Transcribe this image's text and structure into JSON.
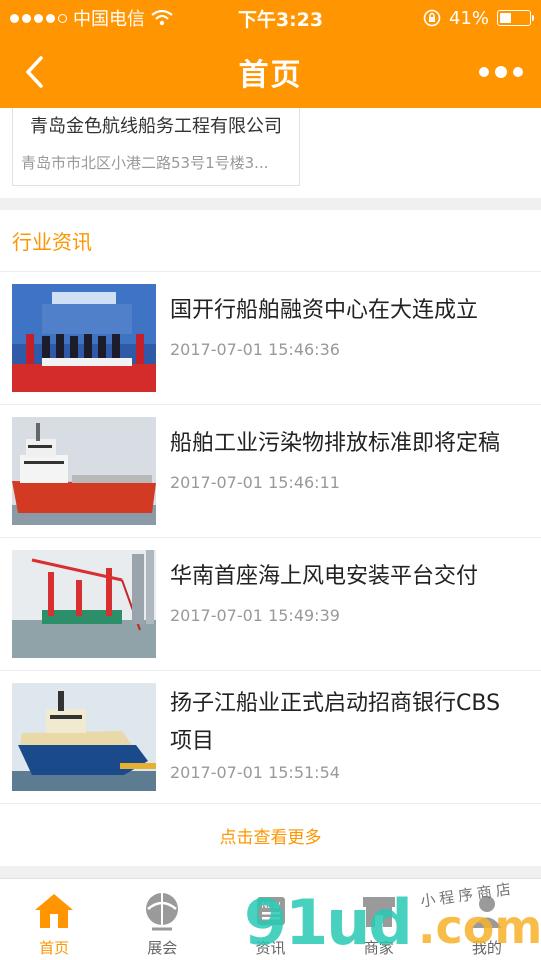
{
  "status_bar": {
    "carrier": "中国电信",
    "time": "下午3:23",
    "battery": "41%",
    "battery_level": 0.41
  },
  "nav": {
    "title": "首页"
  },
  "company": {
    "name": "青岛金色航线船务工程有限公司",
    "address": "青岛市市北区小港二路53号1号楼3..."
  },
  "news": {
    "section_title": "行业资讯",
    "items": [
      {
        "title": "国开行船舶融资中心在大连成立",
        "time": "2017-07-01 15:46:36",
        "thumb": "signing-ceremony-photo"
      },
      {
        "title": "船舶工业污染物排放标准即将定稿",
        "time": "2017-07-01 15:46:11",
        "thumb": "red-ship-photo"
      },
      {
        "title": "华南首座海上风电安装平台交付",
        "time": "2017-07-01 15:49:39",
        "thumb": "wind-platform-photo"
      },
      {
        "title": "扬子江船业正式启动招商银行CBS项目",
        "time": "2017-07-01 15:51:54",
        "thumb": "icebreaker-ship-photo"
      }
    ],
    "more_label": "点击查看更多"
  },
  "tabs": [
    {
      "label": "首页",
      "icon": "home-icon",
      "active": true
    },
    {
      "label": "展会",
      "icon": "exhibition-icon",
      "active": false
    },
    {
      "label": "资讯",
      "icon": "news-icon",
      "active": false
    },
    {
      "label": "商家",
      "icon": "merchant-icon",
      "active": false
    },
    {
      "label": "我的",
      "icon": "profile-icon",
      "active": false
    }
  ],
  "watermark": {
    "brand": "91ud",
    "domain": ".com",
    "tagline": "小程序商店"
  },
  "colors": {
    "accent": "#ff9500",
    "watermark_teal": "#27c9b3",
    "watermark_yellow": "#f7b22a"
  }
}
